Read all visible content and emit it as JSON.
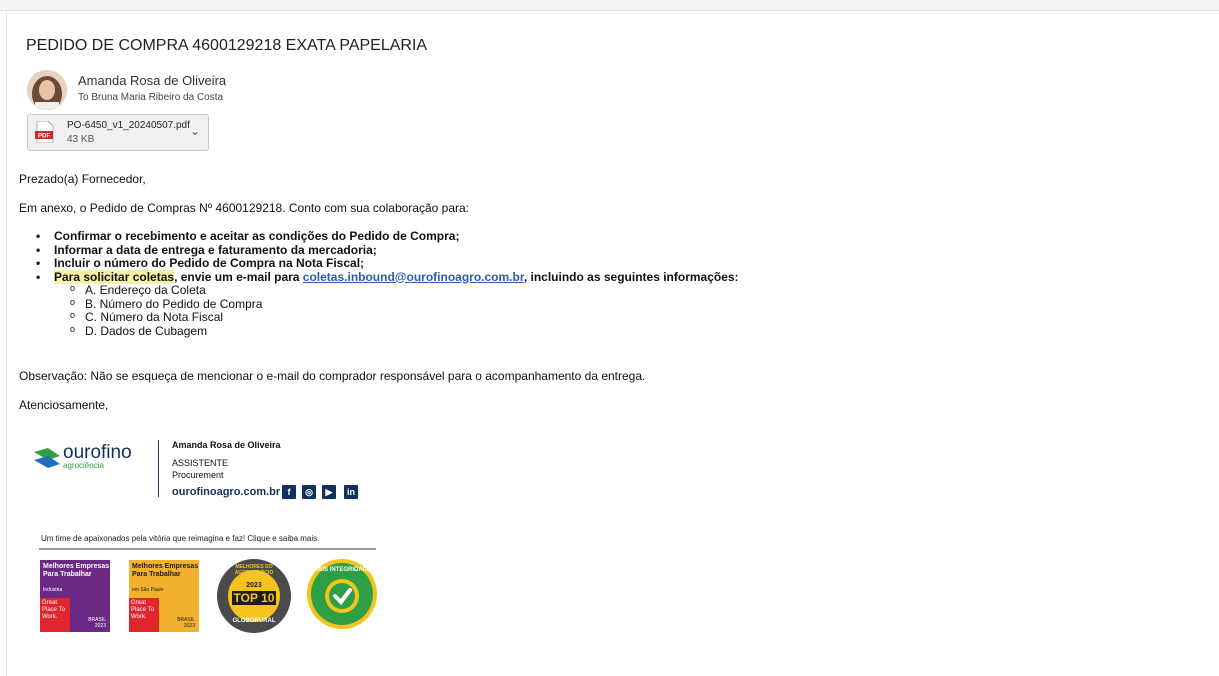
{
  "email": {
    "subject": "PEDIDO DE COMPRA 4600129218 EXATA PAPELARIA",
    "sender": "Amanda Rosa de Oliveira",
    "recipient_line": "To  Bruna Maria Ribeiro da Costa"
  },
  "attachment": {
    "filename": "PO-6450_v1_20240507.pdf",
    "size": "43 KB",
    "type_badge": "PDF",
    "icon": "pdf-file-icon"
  },
  "body": {
    "greeting": "Prezado(a) Fornecedor,",
    "intro": "Em anexo, o Pedido de Compras Nº 4600129218. Conto com sua colaboração para:",
    "bullets": [
      "Confirmar o recebimento e aceitar as condições do Pedido de Compra;",
      "Informar a data de entrega e faturamento da mercadoria;",
      "Incluir o número do Pedido de Compra na Nota Fiscal;"
    ],
    "coletas": {
      "highlight": "Para solicitar coletas",
      "pre_link": ", envie um e-mail para ",
      "email": "coletas.inbound@ourofinoagro.com.br",
      "post_link": ", incluindo as seguintes informações:"
    },
    "sub_items": [
      "A. Endereço da Coleta",
      "B. Número do Pedido de Compra",
      "C. Número da Nota Fiscal",
      "D. Dados de Cubagem"
    ],
    "observation": "Observação: Não se esqueça de mencionar o e-mail do comprador responsável para o acompanhamento da entrega.",
    "closing": "Atenciosamente,"
  },
  "signature": {
    "logo_text": "ourofino",
    "logo_sub": "agrociência",
    "name": "Amanda Rosa de Oliveira",
    "role": "ASSISTENTE",
    "dept": "Procurement",
    "site": "ourofinoagro.com.br",
    "social_icons": [
      "facebook-icon",
      "instagram-icon",
      "youtube-icon",
      "linkedin-icon"
    ],
    "social_glyphs": [
      "f",
      "◎",
      "▶",
      "in"
    ],
    "tagline": "Um time de apaixonados pela vitória que reimagina e faz! Clique e saiba mais."
  },
  "awards": [
    {
      "text": "Melhores Empresas Para Trabalhar",
      "sub": "Indústria",
      "year": "BRASIL 2023",
      "color": "#6a2a84",
      "gptw": "Great Place To Work."
    },
    {
      "text": "Melhores Empresas Para Trabalhar",
      "sub": "em São Paulo",
      "year": "BRASIL 2023",
      "color": "#f2b230",
      "gptw": "Great Place To Work."
    },
    {
      "text": "MELHORES DO AGRONEGÓCIO",
      "sub": "TOP 10",
      "year": "2023",
      "brand": "GLOBORURAL"
    },
    {
      "text": "MAIS INTEGRIDADE"
    }
  ],
  "colors": {
    "link": "#2b5ea8",
    "highlight": "#f6f1a6",
    "brand_navy": "#10315c",
    "brand_green": "#2e9f45"
  }
}
